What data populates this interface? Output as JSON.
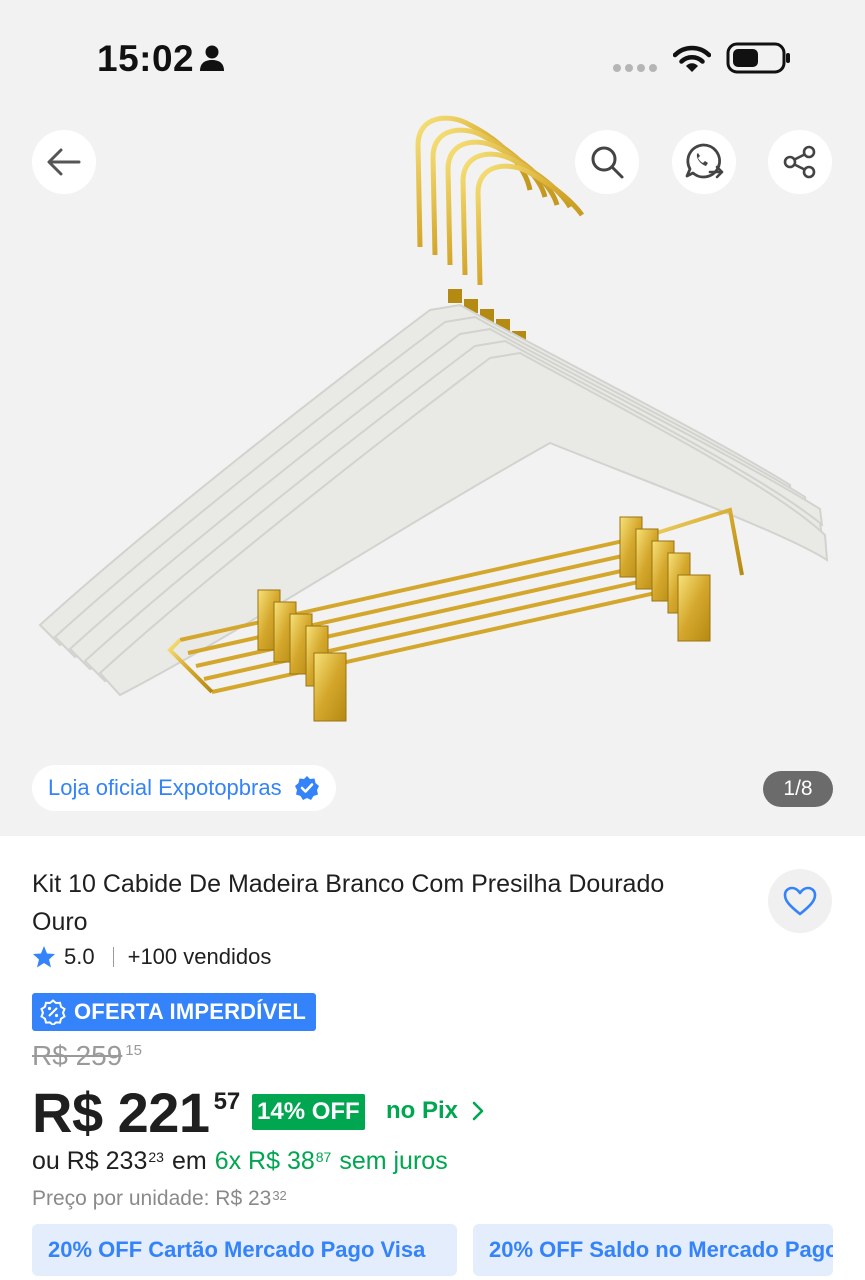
{
  "status_bar": {
    "time": "15:02"
  },
  "gallery": {
    "counter": "1/8",
    "store_label": "Loja oficial Expotopbras",
    "image_alt": "Kit 10 Cabide De Madeira Branco Com Presilha Dourado Ouro"
  },
  "product": {
    "title": "Kit 10 Cabide De Madeira Branco Com Presilha Dourado Ouro",
    "rating": "5.0",
    "sold": "+100 vendidos",
    "offer_badge": "OFERTA IMPERDÍVEL",
    "old_price": "R$ 259",
    "old_price_cents": "15",
    "price": "R$ 221",
    "price_cents": "57",
    "discount": "14% OFF",
    "pix_label": "no Pix",
    "installments": {
      "prefix": "ou R$ 233",
      "prefix_cents": "23",
      "connector": "em",
      "plan": "6x R$ 38",
      "plan_cents": "87",
      "suffix": "sem juros"
    },
    "unit_price": "Preço por unidade: R$ 23",
    "unit_price_cents": "32"
  },
  "promos": [
    {
      "label": "20% OFF Cartão Mercado Pago Visa"
    },
    {
      "label": "20% OFF Saldo no Mercado Pago"
    }
  ],
  "colors": {
    "accent_blue": "#3483fa",
    "green": "#00a650",
    "gallery_bg": "#f2f2f2"
  }
}
